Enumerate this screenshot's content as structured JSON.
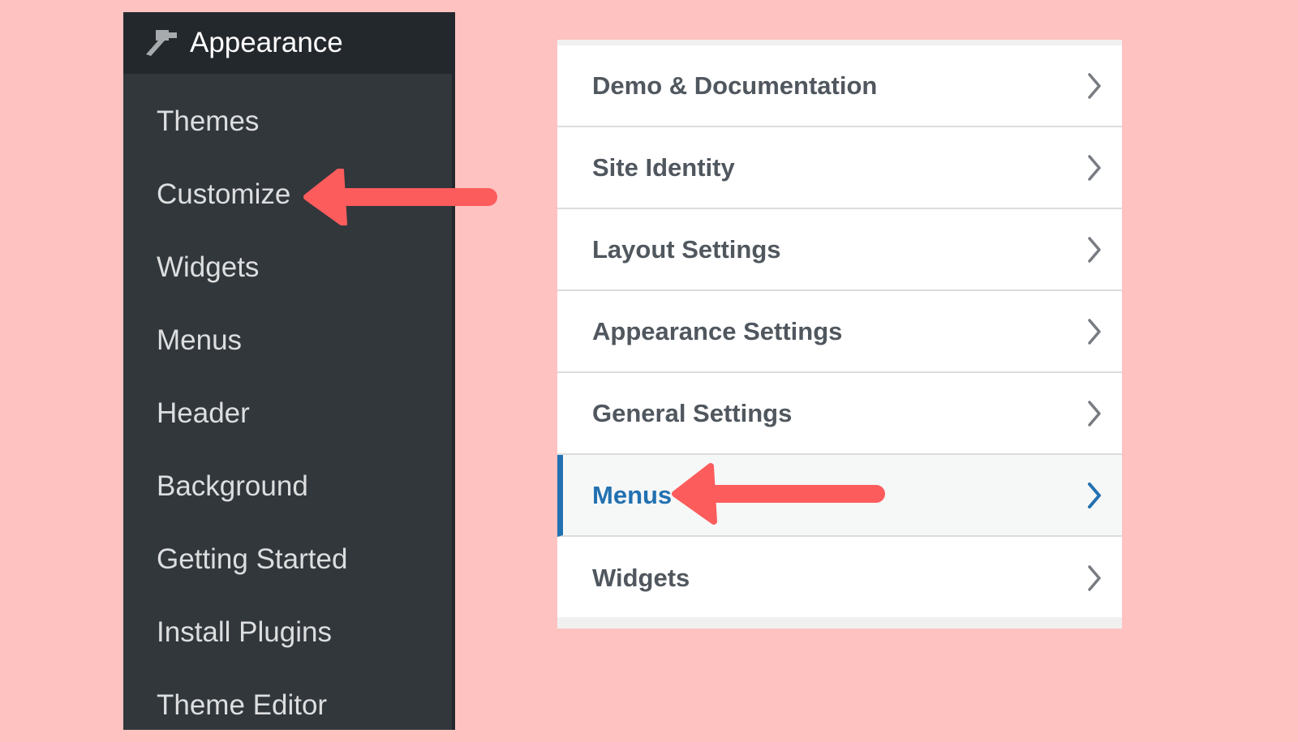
{
  "admin_menu": {
    "header": {
      "icon": "paintbrush-icon",
      "title": "Appearance"
    },
    "items": [
      {
        "label": "Themes"
      },
      {
        "label": "Customize"
      },
      {
        "label": "Widgets"
      },
      {
        "label": "Menus"
      },
      {
        "label": "Header"
      },
      {
        "label": "Background"
      },
      {
        "label": "Getting Started"
      },
      {
        "label": "Install Plugins"
      },
      {
        "label": "Theme Editor"
      }
    ]
  },
  "customizer": {
    "sections": [
      {
        "label": "Demo & Documentation",
        "icon": "chevron-right-icon"
      },
      {
        "label": "Site Identity",
        "icon": "chevron-right-icon"
      },
      {
        "label": "Layout Settings",
        "icon": "chevron-right-icon"
      },
      {
        "label": "Appearance Settings",
        "icon": "chevron-right-icon"
      },
      {
        "label": "General Settings",
        "icon": "chevron-right-icon"
      },
      {
        "label": "Menus",
        "icon": "chevron-right-icon",
        "active": true
      },
      {
        "label": "Widgets",
        "icon": "chevron-right-icon"
      }
    ]
  },
  "annotations": {
    "arrow_color": "#fd5c5c",
    "arrows": [
      {
        "points_to": "Customize",
        "direction": "left"
      },
      {
        "points_to": "Menus",
        "direction": "left"
      }
    ]
  },
  "colors": {
    "background": "#fec2c1",
    "admin_panel": "#32373c",
    "admin_header": "#23282d",
    "active_accent": "#2271b1"
  }
}
